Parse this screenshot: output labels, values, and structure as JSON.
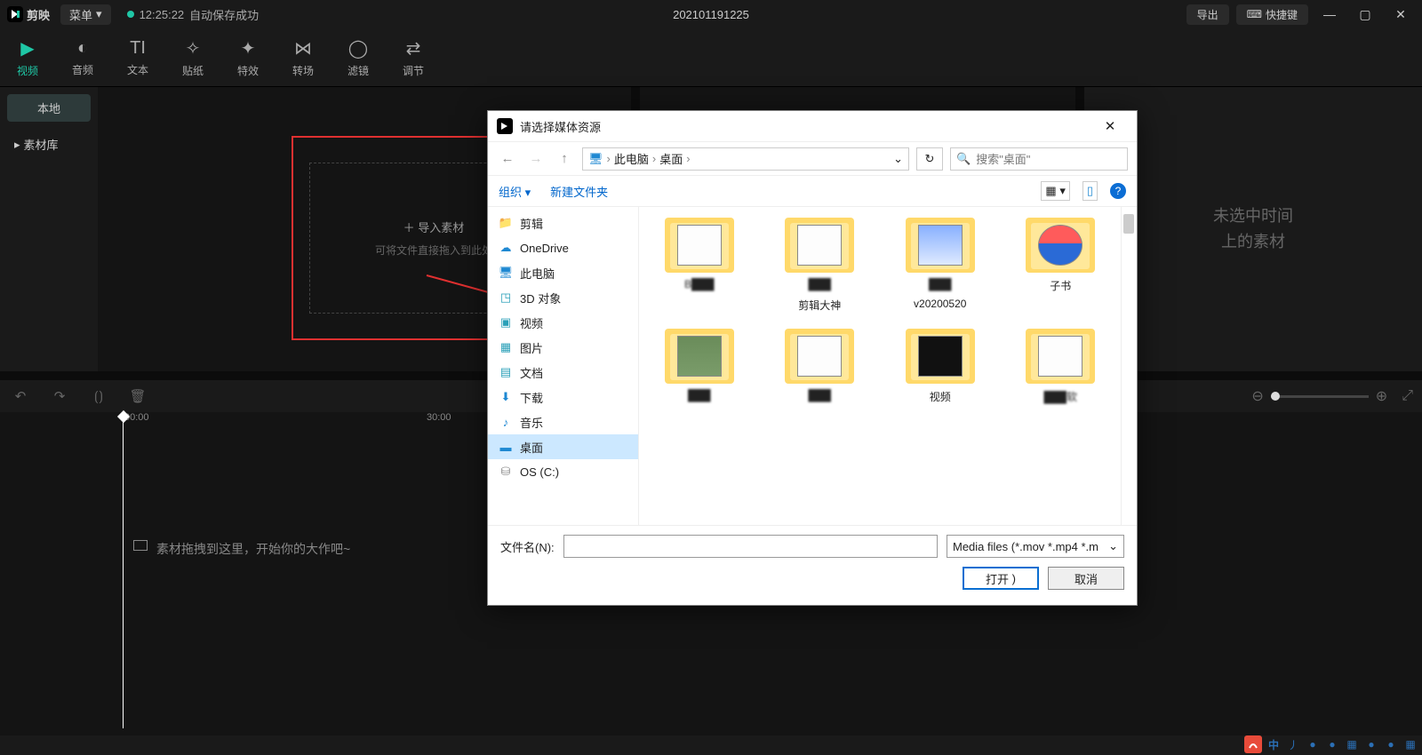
{
  "titlebar": {
    "app": "剪映",
    "menu": "菜单",
    "autosave_time": "12:25:22",
    "autosave_text": "自动保存成功",
    "project": "202101191225",
    "export": "导出",
    "shortcut": "快捷键"
  },
  "tabs": [
    {
      "icon": "▶",
      "label": "视频"
    },
    {
      "icon": "◐",
      "label": "音频"
    },
    {
      "icon": "TI",
      "label": "文本"
    },
    {
      "icon": "✧",
      "label": "贴纸"
    },
    {
      "icon": "✦",
      "label": "特效"
    },
    {
      "icon": "⋈",
      "label": "转场"
    },
    {
      "icon": "◯",
      "label": "滤镜"
    },
    {
      "icon": "⇄",
      "label": "调节"
    }
  ],
  "sidebar": {
    "local": "本地",
    "library": "素材库"
  },
  "import": {
    "title": "导入素材",
    "hint": "可将文件直接拖入到此处"
  },
  "prop": {
    "line1": "未选中时间",
    "line2": "上的素材"
  },
  "timeline": {
    "t0": "00:00",
    "t1": "30:00",
    "hint": "素材拖拽到这里，开始你的大作吧~"
  },
  "dialog": {
    "title": "请选择媒体资源",
    "path": [
      "此电脑",
      "桌面"
    ],
    "search_placeholder": "搜索\"桌面\"",
    "organize": "组织",
    "newfolder": "新建文件夹",
    "tree": [
      {
        "icon": "📁",
        "label": "剪辑",
        "color": "#f7c95e"
      },
      {
        "icon": "☁",
        "label": "OneDrive",
        "color": "#1e88d2"
      },
      {
        "icon": "🖥",
        "label": "此电脑",
        "color": "#1e88d2"
      },
      {
        "icon": "◳",
        "label": "3D 对象",
        "color": "#2aa0b8"
      },
      {
        "icon": "▣",
        "label": "视频",
        "color": "#2aa0b8"
      },
      {
        "icon": "▦",
        "label": "图片",
        "color": "#2aa0b8"
      },
      {
        "icon": "▤",
        "label": "文档",
        "color": "#2aa0b8"
      },
      {
        "icon": "⬇",
        "label": "下载",
        "color": "#1e88d2"
      },
      {
        "icon": "♪",
        "label": "音乐",
        "color": "#1e88d2"
      },
      {
        "icon": "▬",
        "label": "桌面",
        "color": "#1e88d2",
        "selected": true
      },
      {
        "icon": "⛁",
        "label": "OS (C:)",
        "color": "#888"
      }
    ],
    "files_row1": [
      {
        "thumb": "white",
        "name": "B███"
      },
      {
        "thumb": "white",
        "name": "███",
        "name2": "剪辑大神"
      },
      {
        "thumb": "pic",
        "name": "███",
        "name2": "v20200520"
      },
      {
        "thumb": "pink",
        "name": "子书"
      }
    ],
    "files_row2": [
      {
        "thumb": "photo",
        "name": "███"
      },
      {
        "thumb": "white",
        "name": "███"
      },
      {
        "thumb": "black",
        "name": "视频"
      },
      {
        "thumb": "white",
        "name": "███软"
      }
    ],
    "filename_label": "文件名(N):",
    "filetype": "Media files (*.mov *.mp4 *.m",
    "open": "打开",
    "cancel": "取消"
  },
  "tray": {
    "items": [
      "中",
      "丿",
      "●",
      "●",
      "▦",
      "●",
      "●",
      "▦"
    ]
  }
}
